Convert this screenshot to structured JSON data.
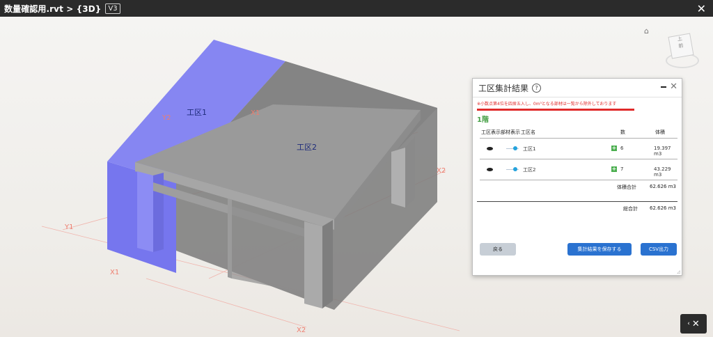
{
  "titlebar": {
    "title": "数量確認用.rvt > {3D}",
    "version": "V3",
    "close": "✕"
  },
  "viewport": {
    "zone_labels": [
      "工区1",
      "工区2"
    ],
    "grid_labels": [
      "Y2",
      "X1",
      "X2",
      "Y1",
      "X1",
      "X2"
    ],
    "viewcube": {
      "home_icon": "home-icon",
      "top_label": "上",
      "front_label": "前"
    }
  },
  "panel": {
    "title": "工区集計結果",
    "help_icon": "?",
    "notice": "※小数点第4位を四捨五入し、0m³となる部材は一覧から除外しております",
    "floor": "1階",
    "columns": [
      "工区表示",
      "部材表示",
      "工区名",
      "数",
      "体積"
    ],
    "rows": [
      {
        "name": "工区1",
        "count": "6",
        "volume": "19.397 m3"
      },
      {
        "name": "工区2",
        "count": "7",
        "volume": "43.229 m3"
      }
    ],
    "subtotal_label": "体積合計",
    "subtotal_value": "62.626 m3",
    "total_label": "総合計",
    "total_value": "62.626 m3",
    "buttons": {
      "back": "戻る",
      "save": "集計結果を保存する",
      "csv": "CSV出力"
    },
    "accent": "#2a72d0",
    "warning_color": "#e02a2a"
  },
  "tools_button": "✕"
}
